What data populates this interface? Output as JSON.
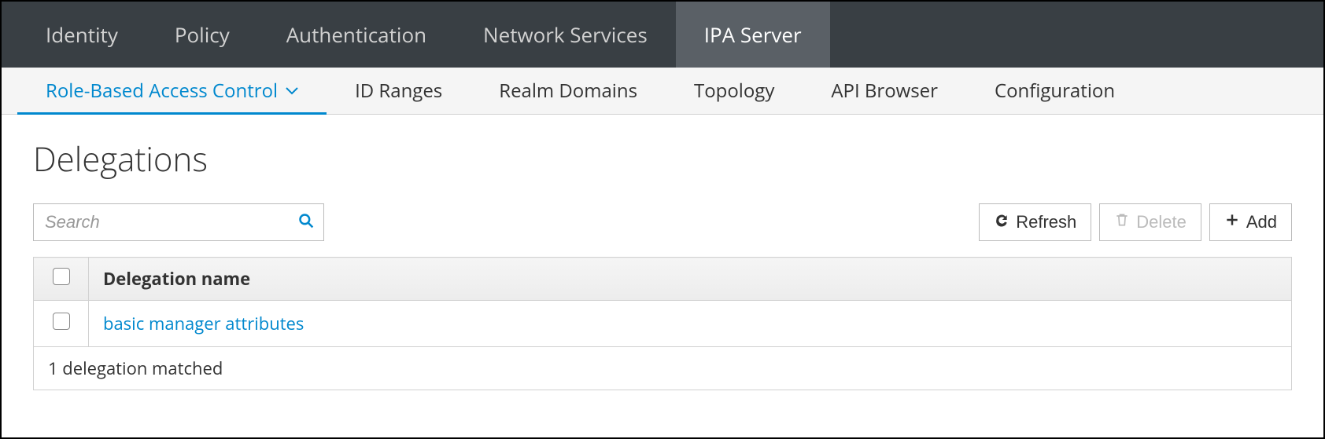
{
  "topnav": {
    "items": [
      {
        "label": "Identity"
      },
      {
        "label": "Policy"
      },
      {
        "label": "Authentication"
      },
      {
        "label": "Network Services"
      },
      {
        "label": "IPA Server"
      }
    ],
    "active_index": 4
  },
  "subnav": {
    "items": [
      {
        "label": "Role-Based Access Control",
        "has_dropdown": true
      },
      {
        "label": "ID Ranges"
      },
      {
        "label": "Realm Domains"
      },
      {
        "label": "Topology"
      },
      {
        "label": "API Browser"
      },
      {
        "label": "Configuration"
      }
    ],
    "active_index": 0
  },
  "page": {
    "title": "Delegations"
  },
  "search": {
    "placeholder": "Search",
    "value": ""
  },
  "actions": {
    "refresh_label": "Refresh",
    "delete_label": "Delete",
    "add_label": "Add"
  },
  "table": {
    "header": {
      "col_name": "Delegation name"
    },
    "rows": [
      {
        "name": "basic manager attributes"
      }
    ],
    "footer": "1 delegation matched"
  }
}
